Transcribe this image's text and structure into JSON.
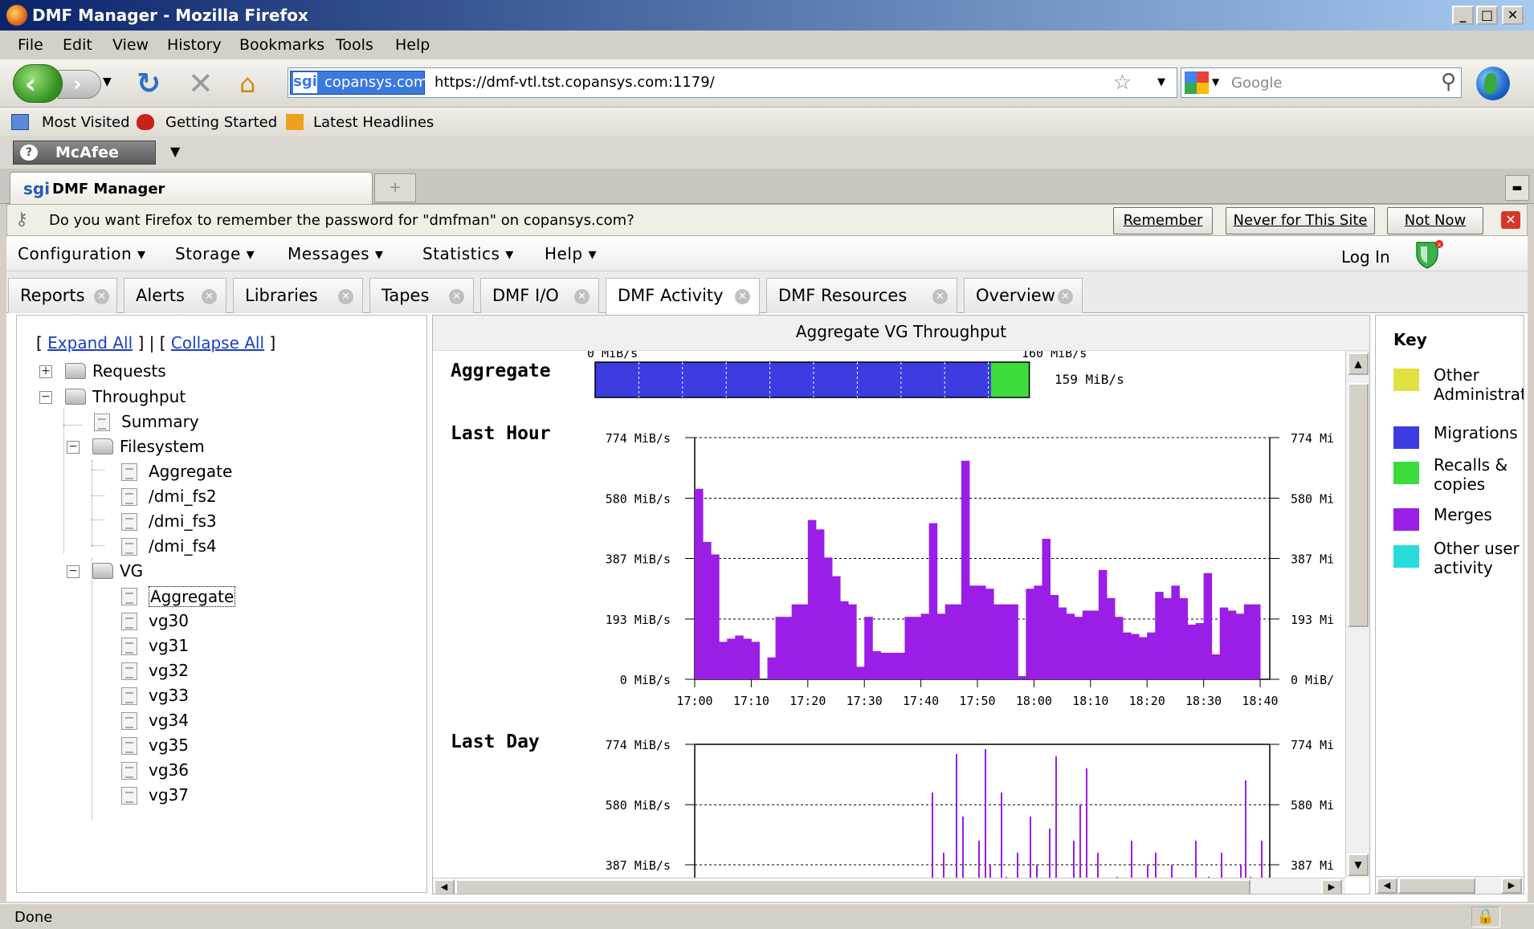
{
  "window": {
    "title": "DMF Manager - Mozilla Firefox"
  },
  "menubar": {
    "items": [
      "File",
      "Edit",
      "View",
      "History",
      "Bookmarks",
      "Tools",
      "Help"
    ]
  },
  "navbar": {
    "url_site": "copansys.com",
    "url_site_icon": "sgi",
    "url": "https://dmf-vtl.tst.copansys.com:1179/",
    "search_placeholder": "Google"
  },
  "bookmarks": {
    "items": [
      "Most Visited",
      "Getting Started",
      "Latest Headlines"
    ]
  },
  "mcafee": {
    "label": "McAfee"
  },
  "browser_tab": {
    "icon": "sgi",
    "title": "DMF Manager",
    "new_tab_glyph": "+"
  },
  "password_bar": {
    "message": "Do you want Firefox to remember the password for \"dmfman\" on copansys.com?",
    "remember": "Remember",
    "never": "Never for This Site",
    "not_now": "Not Now"
  },
  "app_menu": {
    "items": [
      "Configuration",
      "Storage",
      "Messages",
      "Statistics",
      "Help"
    ],
    "login": "Log In"
  },
  "app_tabs": [
    "Reports",
    "Alerts",
    "Libraries",
    "Tapes",
    "DMF I/O",
    "DMF Activity",
    "DMF Resources",
    "Overview"
  ],
  "active_tab": "DMF Activity",
  "tree": {
    "expand_all": "Expand All",
    "collapse_all": "Collapse All",
    "nodes": {
      "requests": "Requests",
      "throughput": "Throughput",
      "summary": "Summary",
      "filesystem": "Filesystem",
      "fs_aggregate": "Aggregate",
      "fs2": "/dmi_fs2",
      "fs3": "/dmi_fs3",
      "fs4": "/dmi_fs4",
      "vg": "VG",
      "vg_aggregate": "Aggregate",
      "vgs": [
        "vg30",
        "vg31",
        "vg32",
        "vg33",
        "vg34",
        "vg35",
        "vg36",
        "vg37"
      ]
    },
    "selected": "vg_aggregate"
  },
  "chart_panel": {
    "header": "Aggregate VG Throughput"
  },
  "chart_data": [
    {
      "type": "bar",
      "title": "Aggregate",
      "orientation": "horizontal-stacked",
      "xlim": [
        0,
        160
      ],
      "x_labels": [
        "0 MiB/s",
        "160 MiB/s"
      ],
      "series": [
        {
          "name": "Migrations",
          "value": 145
        },
        {
          "name": "Recalls & copies",
          "value": 14
        }
      ],
      "total_label": "159 MiB/s"
    },
    {
      "type": "bar",
      "title": "Last Hour",
      "ylim": [
        0,
        774
      ],
      "y_ticks": [
        "0 MiB/s",
        "193 MiB/s",
        "387 MiB/s",
        "580 MiB/s",
        "774 MiB/s"
      ],
      "right_ticks": [
        "0 MiB/",
        "193 Mi",
        "387 Mi",
        "580 Mi",
        "774 Mi"
      ],
      "x_ticks": [
        "17:00",
        "17:10",
        "17:20",
        "17:30",
        "17:40",
        "17:50",
        "18:00",
        "18:10",
        "18:20",
        "18:30",
        "18:40"
      ],
      "series": [
        {
          "name": "Merges",
          "values": [
            610,
            440,
            400,
            120,
            130,
            140,
            130,
            120,
            0,
            70,
            200,
            200,
            240,
            240,
            510,
            480,
            390,
            330,
            250,
            240,
            40,
            200,
            90,
            85,
            85,
            85,
            200,
            200,
            210,
            500,
            210,
            240,
            240,
            700,
            300,
            300,
            290,
            240,
            240,
            240,
            10,
            290,
            300,
            450,
            270,
            230,
            210,
            200,
            220,
            220,
            350,
            260,
            200,
            150,
            145,
            135,
            150,
            280,
            260,
            300,
            260,
            175,
            180,
            340,
            80,
            230,
            220,
            210,
            240,
            240
          ]
        }
      ]
    },
    {
      "type": "bar",
      "title": "Last Day",
      "ylim": [
        0,
        774
      ],
      "y_ticks": [
        "387 MiB/s",
        "580 MiB/s",
        "774 MiB/s"
      ],
      "right_ticks": [
        "387 Mi",
        "580 Mi",
        "774 Mi"
      ],
      "series": [
        {
          "name": "Merges"
        }
      ]
    }
  ],
  "key": {
    "title": "Key",
    "items": [
      {
        "label": "Other Administrat",
        "color": "#e0e040"
      },
      {
        "label": "Migrations",
        "color": "#3c3ce0"
      },
      {
        "label": "Recalls & copies",
        "color": "#3cdc3c"
      },
      {
        "label": "Merges",
        "color": "#9a1ee6"
      },
      {
        "label": "Other user activity",
        "color": "#28dcdc"
      }
    ]
  },
  "status": {
    "text": "Done"
  }
}
